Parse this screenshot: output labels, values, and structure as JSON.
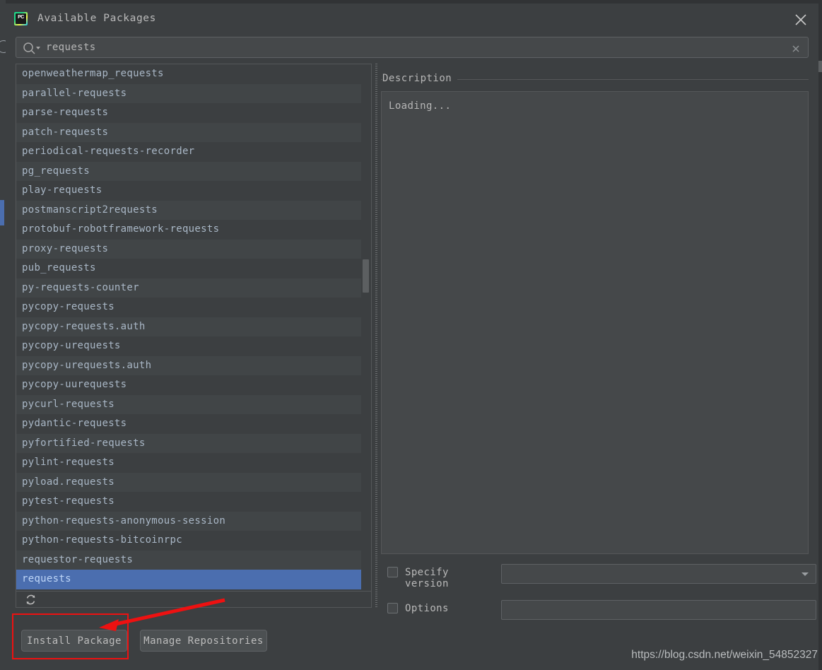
{
  "window": {
    "title": "Available Packages",
    "app_icon": "pycharm-icon",
    "icon_text": "PC",
    "close_icon": "close-icon"
  },
  "search": {
    "icon": "search-icon",
    "value": "requests",
    "placeholder": "",
    "clear_icon": "clear-icon"
  },
  "package_list": {
    "selected": "requests",
    "refresh_icon": "refresh-icon",
    "items": [
      "openweathermap_requests",
      "parallel-requests",
      "parse-requests",
      "patch-requests",
      "periodical-requests-recorder",
      "pg_requests",
      "play-requests",
      "postmanscript2requests",
      "protobuf-robotframework-requests",
      "proxy-requests",
      "pub_requests",
      "py-requests-counter",
      "pycopy-requests",
      "pycopy-requests.auth",
      "pycopy-urequests",
      "pycopy-urequests.auth",
      "pycopy-uurequests",
      "pycurl-requests",
      "pydantic-requests",
      "pyfortified-requests",
      "pylint-requests",
      "pyload.requests",
      "pytest-requests",
      "python-requests-anonymous-session",
      "python-requests-bitcoinrpc",
      "requestor-requests",
      "requests"
    ]
  },
  "description": {
    "header": "Description",
    "body": "Loading..."
  },
  "options": {
    "specify_version": {
      "label": "Specify version",
      "checked": false,
      "value": ""
    },
    "options_field": {
      "label": "Options",
      "checked": false,
      "value": ""
    }
  },
  "buttons": {
    "install": "Install Package",
    "manage": "Manage Repositories"
  },
  "annotation": {
    "highlight_color": "#ee1111",
    "target": "Install Package"
  },
  "watermark": "https://blog.csdn.net/weixin_54852327",
  "colors": {
    "selection": "#4b6eaf",
    "background": "#3c3f41",
    "row_alt": "#414547",
    "text": "#a9b7c6"
  }
}
